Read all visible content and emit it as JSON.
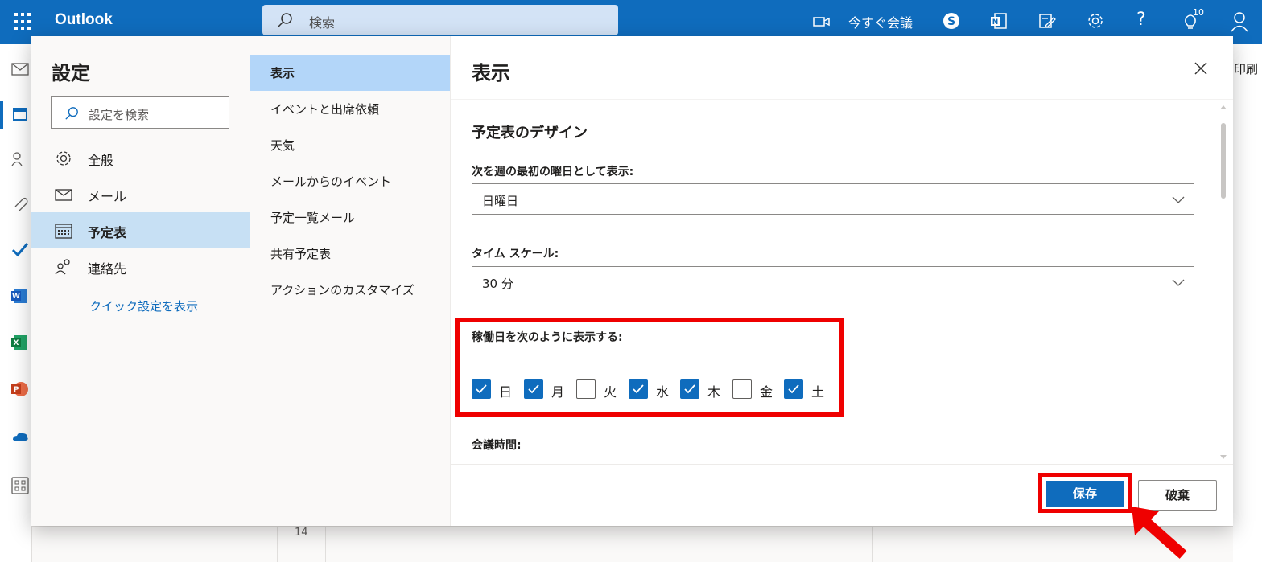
{
  "app": {
    "brand": "Outlook",
    "search_placeholder": "検索",
    "meet_now": "今すぐ会議",
    "tips_badge": "10",
    "print": "印刷",
    "calendar_date": "14"
  },
  "settings": {
    "title": "設定",
    "search_placeholder": "設定を検索",
    "categories": [
      {
        "label": "全般",
        "icon": "gear-icon"
      },
      {
        "label": "メール",
        "icon": "mail-icon"
      },
      {
        "label": "予定表",
        "icon": "calendar-icon",
        "active": true
      },
      {
        "label": "連絡先",
        "icon": "people-icon"
      }
    ],
    "quick_settings": "クイック設定を表示",
    "subcategories": [
      {
        "label": "表示",
        "active": true
      },
      {
        "label": "イベントと出席依頼"
      },
      {
        "label": "天気"
      },
      {
        "label": "メールからのイベント"
      },
      {
        "label": "予定一覧メール"
      },
      {
        "label": "共有予定表"
      },
      {
        "label": "アクションのカスタマイズ"
      }
    ]
  },
  "pane": {
    "title": "表示",
    "section_title": "予定表のデザイン",
    "first_day_label": "次を週の最初の曜日として表示:",
    "first_day_value": "日曜日",
    "time_scale_label": "タイム スケール:",
    "time_scale_value": "30 分",
    "work_days_label": "稼働日を次のように表示する:",
    "days": [
      {
        "label": "日",
        "checked": true
      },
      {
        "label": "月",
        "checked": true
      },
      {
        "label": "火",
        "checked": false
      },
      {
        "label": "水",
        "checked": true
      },
      {
        "label": "木",
        "checked": true
      },
      {
        "label": "金",
        "checked": false
      },
      {
        "label": "土",
        "checked": true
      }
    ],
    "meeting_time_label": "会議時間:",
    "save": "保存",
    "discard": "破棄"
  },
  "colors": {
    "brand_blue": "#0f6cbd",
    "highlight_red": "#ef0000",
    "active_nav": "#c7e0f4"
  }
}
